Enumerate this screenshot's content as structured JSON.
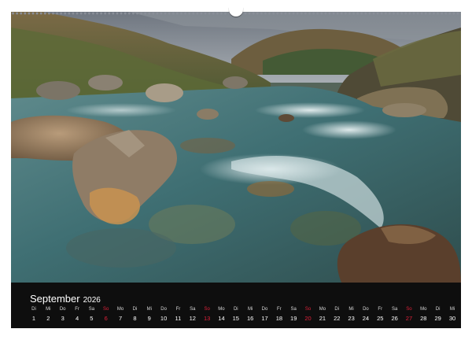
{
  "calendar": {
    "month": "September",
    "year": "2026",
    "weekend_color": "#e0213a",
    "days": [
      {
        "dow": "Di",
        "num": "1"
      },
      {
        "dow": "Mi",
        "num": "2"
      },
      {
        "dow": "Do",
        "num": "3"
      },
      {
        "dow": "Fr",
        "num": "4"
      },
      {
        "dow": "Sa",
        "num": "5"
      },
      {
        "dow": "So",
        "num": "6",
        "sunday": true
      },
      {
        "dow": "Mo",
        "num": "7"
      },
      {
        "dow": "Di",
        "num": "8"
      },
      {
        "dow": "Mi",
        "num": "9"
      },
      {
        "dow": "Do",
        "num": "10"
      },
      {
        "dow": "Fr",
        "num": "11"
      },
      {
        "dow": "Sa",
        "num": "12"
      },
      {
        "dow": "So",
        "num": "13",
        "sunday": true
      },
      {
        "dow": "Mo",
        "num": "14"
      },
      {
        "dow": "Di",
        "num": "15"
      },
      {
        "dow": "Mi",
        "num": "16"
      },
      {
        "dow": "Do",
        "num": "17"
      },
      {
        "dow": "Fr",
        "num": "18"
      },
      {
        "dow": "Sa",
        "num": "19"
      },
      {
        "dow": "So",
        "num": "20",
        "sunday": true
      },
      {
        "dow": "Mo",
        "num": "21"
      },
      {
        "dow": "Di",
        "num": "22"
      },
      {
        "dow": "Mi",
        "num": "23"
      },
      {
        "dow": "Do",
        "num": "24"
      },
      {
        "dow": "Fr",
        "num": "25"
      },
      {
        "dow": "Sa",
        "num": "26"
      },
      {
        "dow": "So",
        "num": "27",
        "sunday": true
      },
      {
        "dow": "Mo",
        "num": "28"
      },
      {
        "dow": "Di",
        "num": "29"
      },
      {
        "dow": "Mi",
        "num": "30"
      }
    ]
  }
}
